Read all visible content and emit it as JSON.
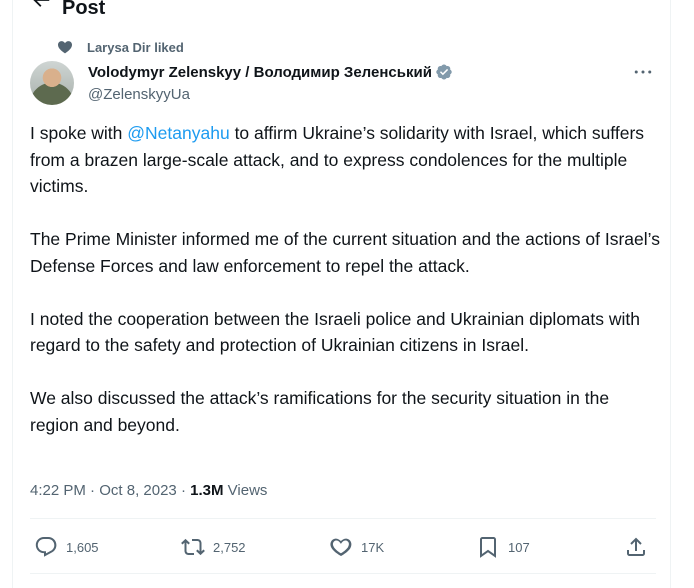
{
  "header": {
    "title": "Post"
  },
  "social_context": {
    "text": "Larysa Dir liked"
  },
  "author": {
    "display_name": "Volodymyr Zelenskyy / Володимир Зеленський",
    "handle": "@ZelenskyyUa",
    "verified_color": "#829aab"
  },
  "tweet": {
    "p1_before": "I spoke with ",
    "p1_mention": "@Netanyahu",
    "p1_after": " to affirm Ukraine’s solidarity with Israel, which suffers from a brazen large-scale attack, and to express condolences for the multiple victims.",
    "p2": "The Prime Minister informed me of the current situation and the actions of Israel’s Defense Forces and law enforcement to repel the attack.",
    "p3": "I noted the cooperation between the Israeli police and Ukrainian diplomats with regard to the safety and protection of Ukrainian citizens in Israel.",
    "p4": "We also discussed the attack’s ramifications for the security situation in the region and beyond."
  },
  "meta": {
    "time": "4:22 PM",
    "separator": " · ",
    "date": "Oct 8, 2023",
    "views_count": "1.3M",
    "views_label": "Views"
  },
  "actions": {
    "replies": "1,605",
    "reposts": "2,752",
    "likes": "17K",
    "bookmarks": "107"
  },
  "colors": {
    "accent": "#1d9bf0",
    "muted": "#536471",
    "text": "#0f1419"
  },
  "icons": [
    "back-arrow-icon",
    "heart-icon",
    "verified-badge-icon",
    "more-icon",
    "reply-icon",
    "retweet-icon",
    "like-icon",
    "bookmark-icon",
    "share-icon"
  ]
}
